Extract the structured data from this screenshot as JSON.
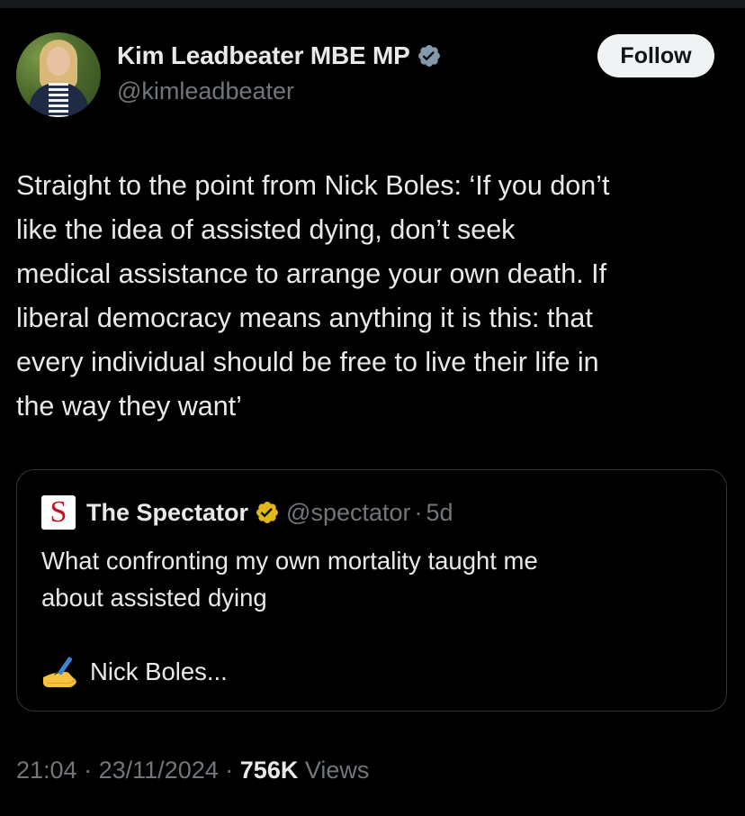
{
  "author": {
    "name": "Kim Leadbeater MBE MP",
    "handle": "@kimleadbeater",
    "verified_color": "#829aab"
  },
  "actions": {
    "follow_label": "Follow"
  },
  "tweet": {
    "text": "Straight to the point from Nick Boles: ‘If you don’t\nlike the idea of assisted dying, don’t seek\nmedical assistance to arrange your own death. If\nliberal democracy means anything it is this: that\nevery individual should be free to live their life in\nthe way they want’"
  },
  "quoted": {
    "logo_letter": "S",
    "name": "The Spectator",
    "handle": "@spectator",
    "separator": "·",
    "age": "5d",
    "verified_color": "#e2b719",
    "text": "What confronting my own mortality taught me\nabout assisted dying",
    "author_line": "Nick Boles...",
    "author_icon": "writing-hand-icon"
  },
  "meta": {
    "time": "21:04",
    "sep1": "·",
    "date": "23/11/2024",
    "sep2": "·",
    "views_count": "756K",
    "views_label": "Views"
  },
  "colors": {
    "background": "#000000",
    "text": "#e7e9ea",
    "muted": "#71767b",
    "border": "#333639"
  }
}
